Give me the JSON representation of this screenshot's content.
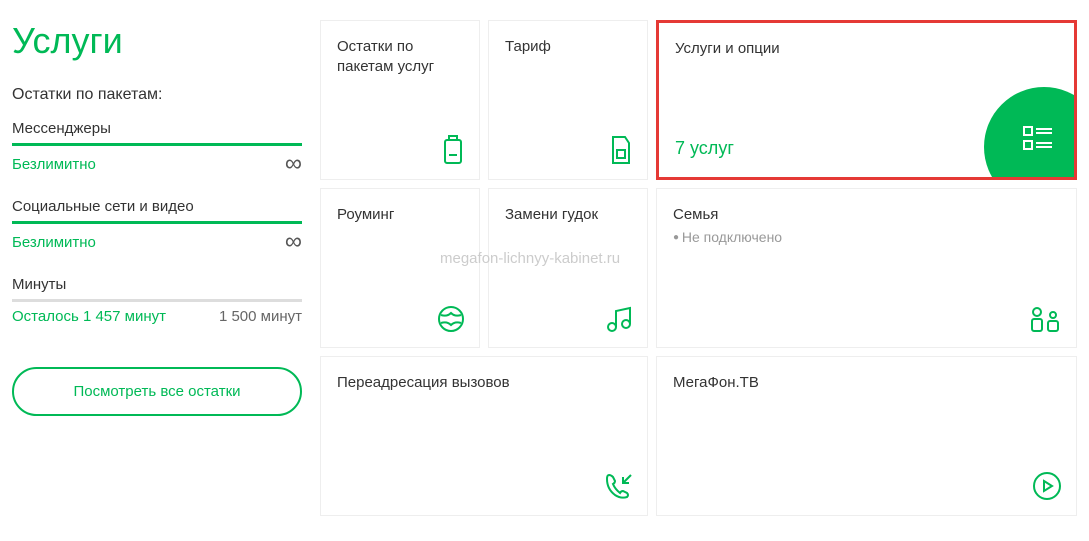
{
  "page": {
    "title": "Услуги",
    "section_header": "Остатки по пакетам:"
  },
  "usage": {
    "items": [
      {
        "label": "Мессенджеры",
        "status": "Безлимитно",
        "unlimited": true
      },
      {
        "label": "Социальные сети и видео",
        "status": "Безлимитно",
        "unlimited": true
      },
      {
        "label": "Минуты",
        "status": "Осталось 1 457 минут",
        "total": "1 500 минут",
        "unlimited": false
      }
    ]
  },
  "view_all_button": "Посмотреть все остатки",
  "cards": {
    "packages": {
      "title": "Остатки по пакетам услуг"
    },
    "tariff": {
      "title": "Тариф"
    },
    "services": {
      "title": "Услуги и опции",
      "footer": "7 услуг"
    },
    "roaming": {
      "title": "Роуминг"
    },
    "ringtone": {
      "title": "Замени гудок"
    },
    "family": {
      "title": "Семья",
      "subtitle": "Не подключено"
    },
    "forwarding": {
      "title": "Переадресация вызовов"
    },
    "tv": {
      "title": "МегаФон.ТВ"
    }
  },
  "watermark": "megafon-lichnyy-kabinet.ru"
}
